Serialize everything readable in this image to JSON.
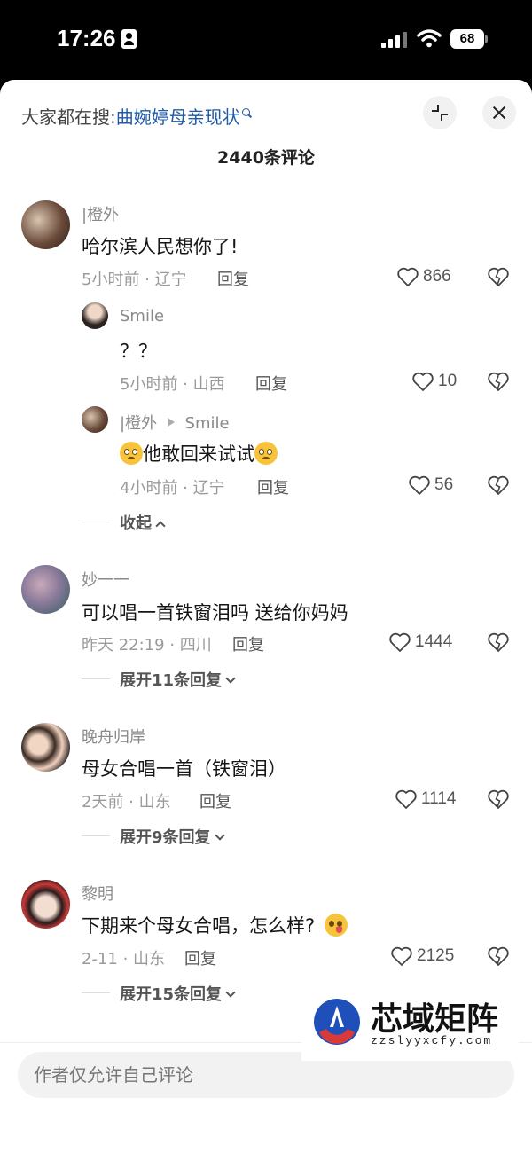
{
  "status_bar": {
    "time": "17:26",
    "battery": "68"
  },
  "header": {
    "search_prefix": "大家都在搜:",
    "search_query": "曲婉婷母亲现状",
    "comment_count": "2440条评论"
  },
  "comments": [
    {
      "username": "|橙外",
      "content": "哈尔滨人民想你了!",
      "meta": "5小时前 · 辽宁",
      "reply": "回复",
      "likes": "866",
      "replies": [
        {
          "username": "Smile",
          "content": "？？",
          "meta": "5小时前 · 山西",
          "reply": "回复",
          "likes": "10"
        },
        {
          "username": "|橙外",
          "reply_to": "Smile",
          "content": "他敢回来试试",
          "meta": "4小时前 · 辽宁",
          "reply": "回复",
          "likes": "56"
        }
      ],
      "expand": "收起"
    },
    {
      "username": "妙一一",
      "content": "可以唱一首铁窗泪吗 送给你妈妈",
      "meta": "昨天 22:19 · 四川",
      "reply": "回复",
      "likes": "1444",
      "expand": "展开11条回复"
    },
    {
      "username": "晚舟归岸",
      "content": "母女合唱一首（铁窗泪）",
      "meta": "2天前 · 山东",
      "reply": "回复",
      "likes": "1114",
      "expand": "展开9条回复"
    },
    {
      "username": "黎明",
      "content": "下期来个母女合唱，怎么样?",
      "meta": "2-11 · 山东",
      "reply": "回复",
      "likes": "2125",
      "expand": "展开15条回复"
    }
  ],
  "bottom_bar": {
    "input_placeholder": "作者仅允许自己评论"
  },
  "watermark": {
    "title": "芯域矩阵",
    "url": "zzslyyxcfy.com"
  },
  "colors": {
    "link_blue": "#1e5aa8",
    "text_gray": "#9a9a9a"
  }
}
